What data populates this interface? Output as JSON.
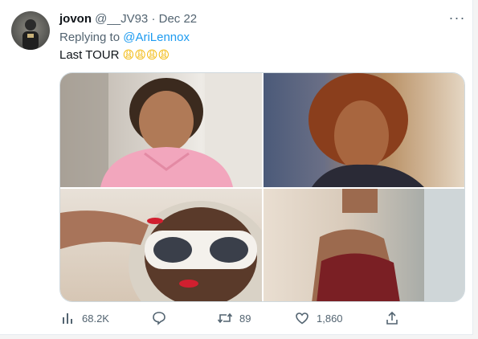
{
  "tweet": {
    "name": "jovon",
    "handle": "@__JV93",
    "separator": "·",
    "date": "Dec 22",
    "replying_prefix": "Replying to",
    "replying_to": "@AriLennox",
    "text": "Last TOUR",
    "emojis": "😩😩😩😩",
    "more": "···"
  },
  "media": {
    "count": 4
  },
  "actions": {
    "views": "68.2K",
    "retweets": "89",
    "likes": "1,860"
  },
  "colors": {
    "link": "#1d9bf0",
    "muted": "#536471",
    "border": "#cfd9de"
  },
  "icons": {
    "views": "analytics-bars-icon",
    "reply": "speech-bubble-icon",
    "retweet": "retweet-arrows-icon",
    "like": "heart-icon",
    "share": "share-upload-icon"
  }
}
